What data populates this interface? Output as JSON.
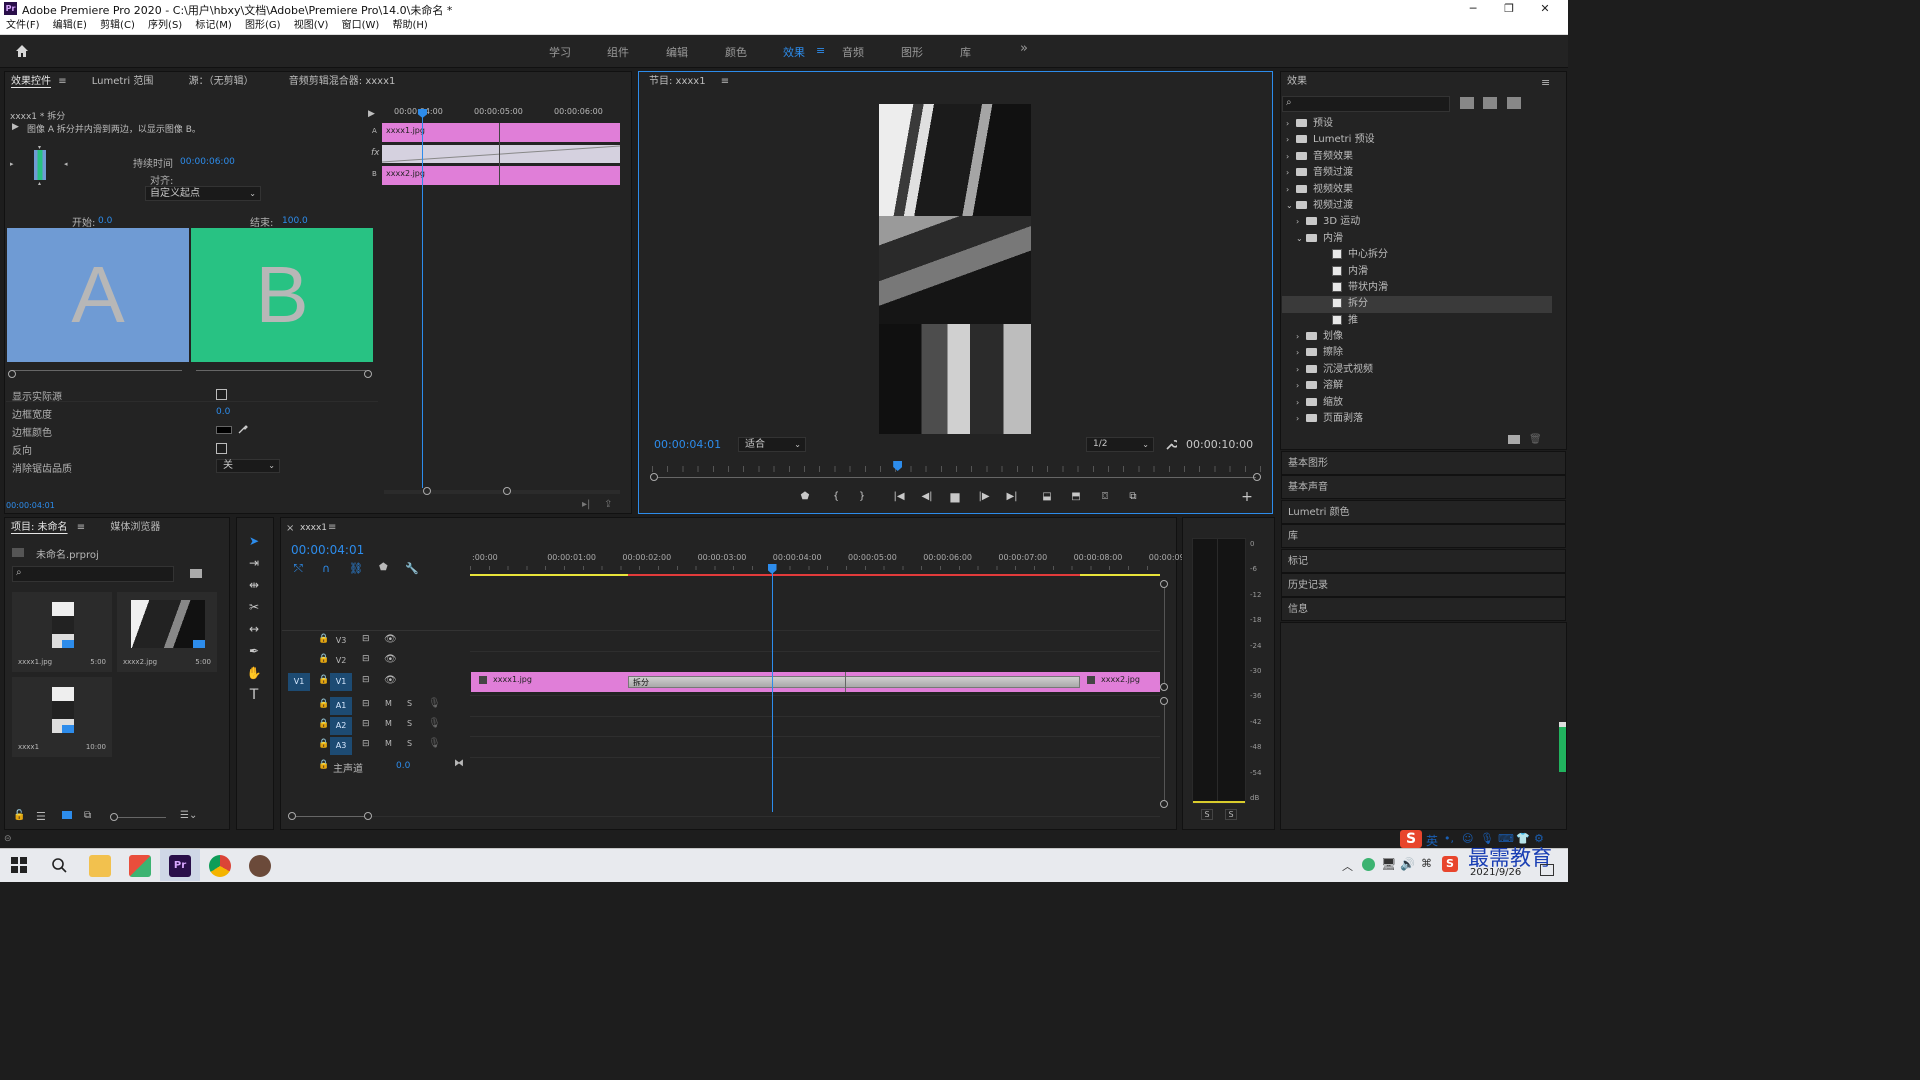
{
  "window": {
    "title": "Adobe Premiere Pro 2020 - C:\\用户\\hbxy\\文档\\Adobe\\Premiere Pro\\14.0\\未命名 *",
    "logo": "Pr",
    "min": "─",
    "max": "❐",
    "close": "✕"
  },
  "menu": [
    "文件(F)",
    "编辑(E)",
    "剪辑(C)",
    "序列(S)",
    "标记(M)",
    "图形(G)",
    "视图(V)",
    "窗口(W)",
    "帮助(H)"
  ],
  "workspaces": {
    "tabs": [
      "学习",
      "组件",
      "编辑",
      "颜色",
      "效果",
      "音频",
      "图形",
      "库"
    ],
    "active_index": 4,
    "menu_icon": "≡",
    "more": "»"
  },
  "effect_controls": {
    "tabs": [
      "效果控件",
      "Lumetri 范围",
      "源：（无剪辑）",
      "音频剪辑混合器: xxxx1"
    ],
    "menu_icon": "≡",
    "clip_title": "xxxx1 * 拆分",
    "description": "图像 A 拆分并内滑到两边，以显示图像 B。",
    "duration_label": "持续时间",
    "duration_value": "00:00:06:00",
    "align_label": "对齐:",
    "align_value": "自定义起点",
    "start_label": "开始:",
    "start_value": "0.0",
    "end_label": "结束:",
    "end_value": "100.0",
    "preview_a": "A",
    "preview_b": "B",
    "show_actual_sources": "显示实际源",
    "border_width_label": "边框宽度",
    "border_width_value": "0.0",
    "border_color_label": "边框颜色",
    "reverse_label": "反向",
    "antialias_label": "消除锯齿品质",
    "antialias_value": "关",
    "timecode": "00:00:04:01",
    "mini_ruler": [
      "00:00:04:00",
      "00:00:05:00",
      "00:00:06:00"
    ],
    "track_a_label": "A",
    "track_b_label": "B",
    "fx_label": "fx",
    "clip_a_name": "xxxx1.jpg",
    "clip_b_name": "xxxx2.jpg",
    "colors": {
      "a_preview": "#6f9bd4",
      "b_preview": "#28c283",
      "clip": "#e07ed8"
    }
  },
  "program_monitor": {
    "title": "节目: xxxx1",
    "menu_icon": "≡",
    "timecode_current": "00:00:04:01",
    "fit_value": "适合",
    "resolution_value": "1/2",
    "timecode_duration": "00:00:10:00",
    "playhead_fraction": 0.4
  },
  "effects_panel": {
    "title": "效果",
    "menu_icon": "≡",
    "tree": [
      {
        "label": "预设",
        "depth": 0,
        "kind": "folder",
        "open": false
      },
      {
        "label": "Lumetri 预设",
        "depth": 0,
        "kind": "folder",
        "open": false
      },
      {
        "label": "音频效果",
        "depth": 0,
        "kind": "folder",
        "open": false
      },
      {
        "label": "音频过渡",
        "depth": 0,
        "kind": "folder",
        "open": false
      },
      {
        "label": "视频效果",
        "depth": 0,
        "kind": "folder",
        "open": false
      },
      {
        "label": "视频过渡",
        "depth": 0,
        "kind": "folder",
        "open": true
      },
      {
        "label": "3D 运动",
        "depth": 1,
        "kind": "folder",
        "open": false
      },
      {
        "label": "内滑",
        "depth": 1,
        "kind": "folder",
        "open": true
      },
      {
        "label": "中心拆分",
        "depth": 2,
        "kind": "fx",
        "open": false
      },
      {
        "label": "内滑",
        "depth": 2,
        "kind": "fx",
        "open": false
      },
      {
        "label": "带状内滑",
        "depth": 2,
        "kind": "fx",
        "open": false
      },
      {
        "label": "拆分",
        "depth": 2,
        "kind": "fx",
        "open": false,
        "selected": true
      },
      {
        "label": "推",
        "depth": 2,
        "kind": "fx",
        "open": false
      },
      {
        "label": "划像",
        "depth": 1,
        "kind": "folder",
        "open": false
      },
      {
        "label": "擦除",
        "depth": 1,
        "kind": "folder",
        "open": false
      },
      {
        "label": "沉浸式视频",
        "depth": 1,
        "kind": "folder",
        "open": false
      },
      {
        "label": "溶解",
        "depth": 1,
        "kind": "folder",
        "open": false
      },
      {
        "label": "缩放",
        "depth": 1,
        "kind": "folder",
        "open": false
      },
      {
        "label": "页面剥落",
        "depth": 1,
        "kind": "folder",
        "open": false
      }
    ],
    "collapsed_panels": [
      "基本图形",
      "基本声音",
      "Lumetri 颜色",
      "库",
      "标记",
      "历史记录",
      "信息"
    ]
  },
  "project_panel": {
    "tabs": [
      "项目: 未命名",
      "媒体浏览器"
    ],
    "menu_icon": "≡",
    "project_file": "未命名.prproj",
    "items": [
      {
        "name": "xxxx1.jpg",
        "duration": "5:00"
      },
      {
        "name": "xxxx2.jpg",
        "duration": "5:00"
      },
      {
        "name": "xxxx1",
        "duration": "10:00"
      }
    ]
  },
  "timeline": {
    "close": "×",
    "sequence_name": "xxxx1",
    "menu_icon": "≡",
    "timecode": "00:00:04:01",
    "ruler": [
      ":00:00",
      "00:00:01:00",
      "00:00:02:00",
      "00:00:03:00",
      "00:00:04:00",
      "00:00:05:00",
      "00:00:06:00",
      "00:00:07:00",
      "00:00:08:00",
      "00:00:09:"
    ],
    "video_tracks": [
      "V3",
      "V2",
      "V1"
    ],
    "audio_tracks": [
      "A1",
      "A2",
      "A3"
    ],
    "source_patch": "V1",
    "master_label": "主声道",
    "master_value": "0.0",
    "clip1": "xxxx1.jpg",
    "clip2": "xxxx2.jpg",
    "transition": "拆分",
    "mute_label": "M",
    "solo_label": "S",
    "playhead_fraction": 0.437
  },
  "audio_meter": {
    "ticks": [
      "0",
      "-6",
      "-12",
      "-18",
      "-24",
      "-30",
      "-36",
      "-42",
      "-48",
      "-54",
      "dB"
    ],
    "solo_left": "S",
    "solo_right": "S"
  },
  "taskbar": {
    "ime": "英",
    "watermark": "最需教育",
    "date": "2021/9/26"
  }
}
